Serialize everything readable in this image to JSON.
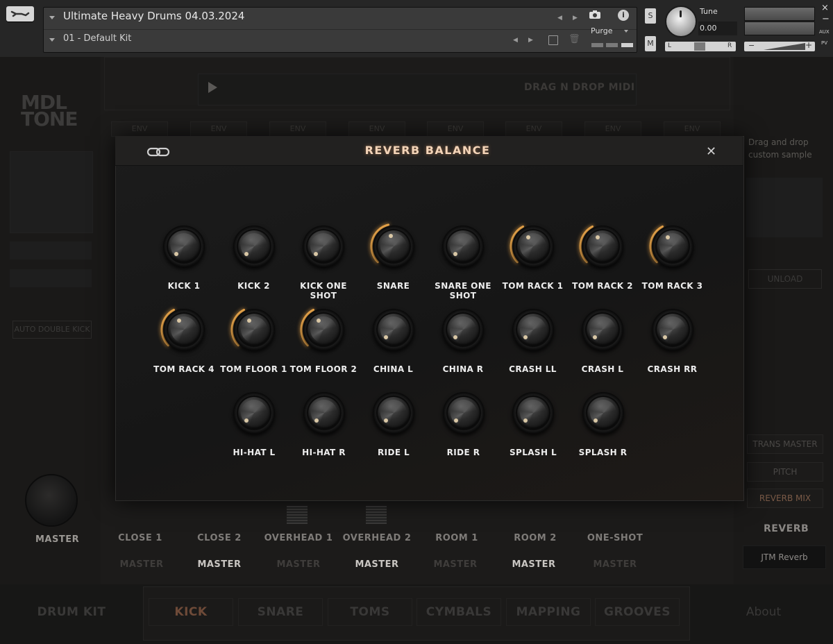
{
  "header": {
    "instrument_name": "Ultimate Heavy Drums 04.03.2024",
    "preset_name": "01 - Default Kit",
    "purge_label": "Purge",
    "solo_label": "S",
    "mute_label": "M",
    "tune_label": "Tune",
    "tune_value": "0.00",
    "pan_left": "L",
    "pan_right": "R",
    "vol_minus": "−",
    "vol_plus": "+",
    "aux_label": "AUX",
    "pv_label": "PV",
    "close_glyph": "×",
    "minimize_glyph": "−"
  },
  "background": {
    "logo_line1": "MDL",
    "logo_line2": "TONE",
    "midi_label": "DRAG N DROP MIDI",
    "env_label": "ENV",
    "auto_double_kick": "AUTO DOUBLE KICK",
    "drag_drop_line1": "Drag and drop",
    "drag_drop_line2": "custom sample",
    "unload": "UNLOAD",
    "right_buttons": [
      "TRANS MASTER",
      "PITCH",
      "REVERB MIX"
    ],
    "reverb_label": "REVERB",
    "reverb_type": "JTM Reverb",
    "master_label": "MASTER",
    "channels": [
      {
        "name": "CLOSE 1",
        "route": "MASTER",
        "active": false
      },
      {
        "name": "CLOSE 2",
        "route": "MASTER",
        "active": true
      },
      {
        "name": "OVERHEAD 1",
        "route": "MASTER",
        "active": false
      },
      {
        "name": "OVERHEAD 2",
        "route": "MASTER",
        "active": true
      },
      {
        "name": "ROOM 1",
        "route": "MASTER",
        "active": false
      },
      {
        "name": "ROOM 2",
        "route": "MASTER",
        "active": true
      },
      {
        "name": "ONE-SHOT",
        "route": "MASTER",
        "active": false
      }
    ],
    "drum_kit_label": "DRUM KIT",
    "tabs": [
      "KICK",
      "SNARE",
      "TOMS",
      "CYMBALS",
      "MAPPING",
      "GROOVES"
    ],
    "active_tab": "KICK",
    "about_label": "About"
  },
  "modal": {
    "title": "REVERB BALANCE",
    "accent_color": "#e9a54a",
    "knobs": [
      {
        "label": "KICK 1",
        "level": 0
      },
      {
        "label": "KICK 2",
        "level": 0
      },
      {
        "label": "KICK ONE SHOT",
        "level": 0
      },
      {
        "label": "SNARE",
        "level": 0.45
      },
      {
        "label": "SNARE ONE SHOT",
        "level": 0
      },
      {
        "label": "TOM RACK 1",
        "level": 0.4
      },
      {
        "label": "TOM RACK 2",
        "level": 0.4
      },
      {
        "label": "TOM RACK 3",
        "level": 0.4
      },
      {
        "label": "TOM RACK 4",
        "level": 0.4
      },
      {
        "label": "TOM FLOOR 1",
        "level": 0.4
      },
      {
        "label": "TOM FLOOR 2",
        "level": 0.4
      },
      {
        "label": "CHINA L",
        "level": 0
      },
      {
        "label": "CHINA R",
        "level": 0
      },
      {
        "label": "CRASH LL",
        "level": 0
      },
      {
        "label": "CRASH L",
        "level": 0
      },
      {
        "label": "CRASH RR",
        "level": 0
      },
      {
        "label": "HI-HAT L",
        "level": 0
      },
      {
        "label": "HI-HAT R",
        "level": 0
      },
      {
        "label": "RIDE L",
        "level": 0
      },
      {
        "label": "RIDE R",
        "level": 0
      },
      {
        "label": "SPLASH L",
        "level": 0
      },
      {
        "label": "SPLASH R",
        "level": 0
      }
    ]
  }
}
